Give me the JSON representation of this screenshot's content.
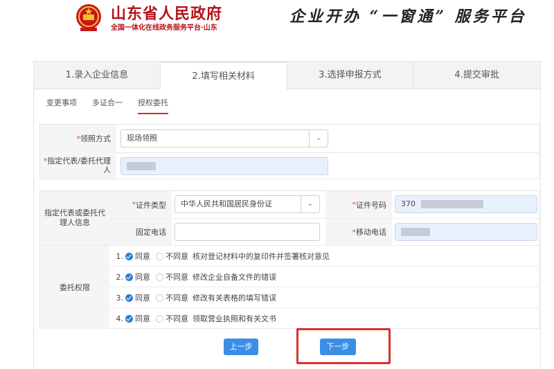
{
  "header": {
    "site_title": "山东省人民政府",
    "site_subtitle": "全国一体化在线政务服务平台·山东",
    "platform_title": "企业开办 “一窗通” 服务平台",
    "emblem_icon": "national-emblem-icon"
  },
  "steps": [
    {
      "label": "1.录入企业信息"
    },
    {
      "label": "2.填写相关材料"
    },
    {
      "label": "3.选择申报方式"
    },
    {
      "label": "4.提交审批"
    }
  ],
  "subtabs": [
    {
      "label": "变更事项"
    },
    {
      "label": "多证合一"
    },
    {
      "label": "授权委托"
    }
  ],
  "form": {
    "pickup": {
      "required": "*",
      "label": "领照方式",
      "value": "现场领照"
    },
    "agent": {
      "required": "*",
      "label": "指定代表/委托代理人"
    },
    "agent_info_label": "指定代表或委托代理人信息",
    "id_type": {
      "required": "*",
      "label": "证件类型",
      "value": "中华人民共和国居民身份证"
    },
    "id_number": {
      "required": "*",
      "label": "证件号码",
      "value": "370"
    },
    "landline": {
      "label": "固定电话",
      "value": ""
    },
    "mobile": {
      "required": "*",
      "label": "移动电话"
    }
  },
  "permissions": {
    "label": "委托权限",
    "agree_label": "同意",
    "disagree_label": "不同意",
    "items": [
      {
        "num": "1.",
        "text": "核对登记材料中的复印件并签署核对意见"
      },
      {
        "num": "2.",
        "text": "修改企业自备文件的错误"
      },
      {
        "num": "3.",
        "text": "修改有关表格的填写错误"
      },
      {
        "num": "4.",
        "text": "领取营业执照和有关文书"
      }
    ]
  },
  "buttons": {
    "prev": "上一步",
    "next": "下一步"
  },
  "colors": {
    "brand_red": "#b5121b",
    "button_blue": "#3a8ee6",
    "highlight_red": "#d9302c"
  }
}
